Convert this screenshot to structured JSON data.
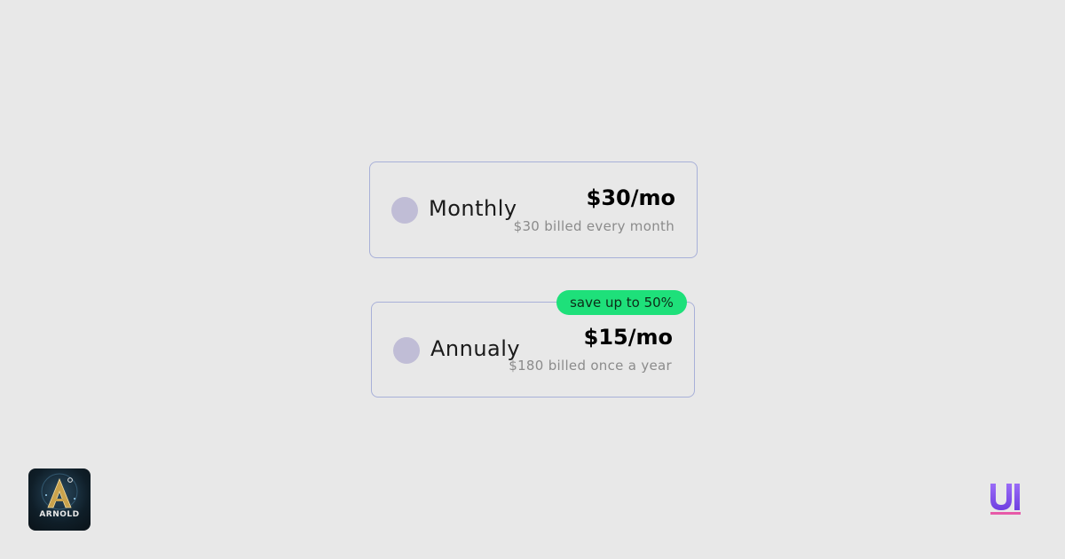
{
  "plans": [
    {
      "label": "Monthly",
      "price": "$30/mo",
      "billing": "$30 billed every month",
      "selected": false
    },
    {
      "label": "Annualy",
      "price": "$15/mo",
      "billing": "$180 billed once a year",
      "selected": false,
      "badge": "save up to 50%"
    }
  ],
  "branding": {
    "logo_text": "ARNOLD",
    "corner_mark": "UI"
  },
  "colors": {
    "background": "#e8e8e8",
    "card_border": "#a8b0d8",
    "radio": "#c0bdd6",
    "badge": "#1ee07a",
    "ui_mark": "#8b5cf6"
  }
}
